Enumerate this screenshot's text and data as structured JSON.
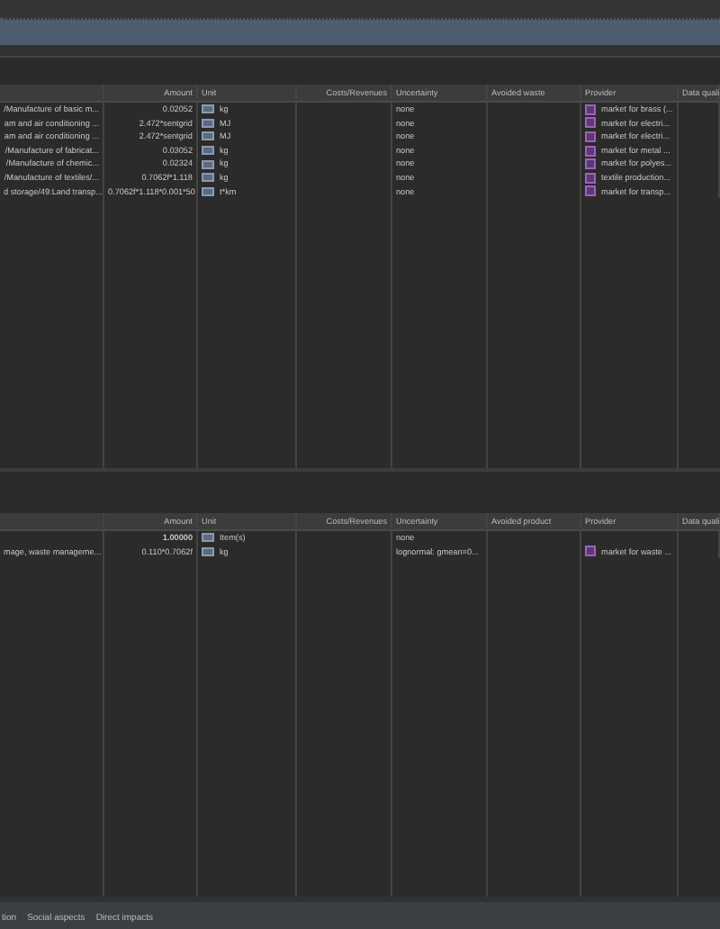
{
  "input_table": {
    "columns": [
      "Amount",
      "Unit",
      "Costs/Revenues",
      "Uncertainty",
      "Avoided waste",
      "Provider",
      "Data quali"
    ],
    "rows": [
      {
        "flow": "/Manufacture of basic m...",
        "amount": "0.02052",
        "unit": "kg",
        "uncertainty": "none",
        "provider": "market for brass (..."
      },
      {
        "flow": "am and air conditioning ...",
        "amount": "2.472*sentgrid",
        "unit": "MJ",
        "uncertainty": "none",
        "provider": "market for electri..."
      },
      {
        "flow": "am and air conditioning ...",
        "amount": "2.472*sentgrid",
        "unit": "MJ",
        "uncertainty": "none",
        "provider": "market for electri..."
      },
      {
        "flow": "/Manufacture of fabricat...",
        "amount": "0.03052",
        "unit": "kg",
        "uncertainty": "none",
        "provider": "market for metal ..."
      },
      {
        "flow": "/Manufacture of chemic...",
        "amount": "0.02324",
        "unit": "kg",
        "uncertainty": "none",
        "provider": "market for polyes..."
      },
      {
        "flow": "/Manufacture of textiles/...",
        "amount": "0.7062f*1.118",
        "unit": "kg",
        "uncertainty": "none",
        "provider": "textile production..."
      },
      {
        "flow": "d storage/49:Land transp...",
        "amount": "0.7062f*1.118*0.001*50",
        "unit": "t*km",
        "uncertainty": "none",
        "provider": "market for transp..."
      }
    ]
  },
  "output_table": {
    "columns": [
      "Amount",
      "Unit",
      "Costs/Revenues",
      "Uncertainty",
      "Avoided product",
      "Provider",
      "Data quali"
    ],
    "rows": [
      {
        "flow": "",
        "amount": "1.00000",
        "reference": true,
        "unit": "Item(s)",
        "uncertainty": "none",
        "provider": ""
      },
      {
        "flow": "mage, waste manageme...",
        "amount": "0.110*0.7062f",
        "reference": false,
        "unit": "kg",
        "uncertainty": "lognormal: gmean=0...",
        "provider": "market for waste ..."
      }
    ]
  },
  "bottom_tabs": [
    {
      "label": "tion"
    },
    {
      "label": "Social aspects"
    },
    {
      "label": "Direct impacts"
    }
  ]
}
